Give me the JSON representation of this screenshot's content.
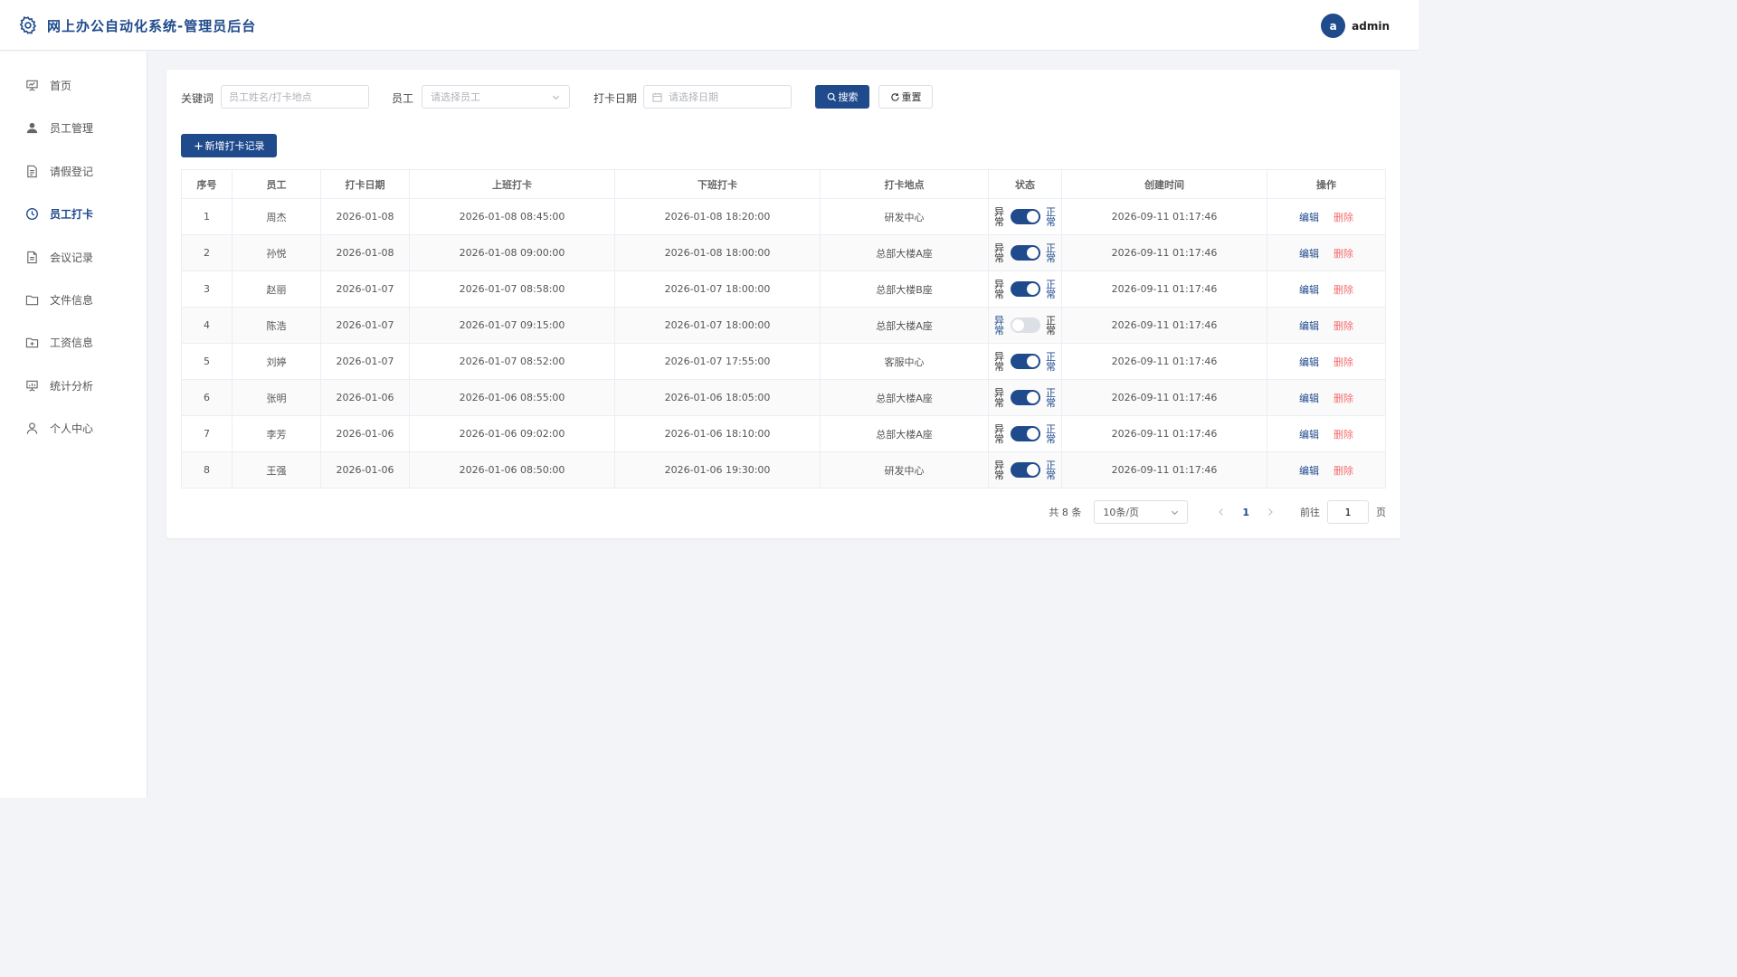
{
  "header": {
    "title": "网上办公自动化系统-管理员后台",
    "logo_icon": "gear-icon",
    "user": {
      "avatar_letter": "a",
      "name": "admin"
    }
  },
  "sidebar": {
    "items": [
      {
        "label": "首页",
        "icon": "presentation-icon",
        "active": false
      },
      {
        "label": "员工管理",
        "icon": "user-icon",
        "active": false
      },
      {
        "label": "请假登记",
        "icon": "document-icon",
        "active": false
      },
      {
        "label": "员工打卡",
        "icon": "clock-icon",
        "active": true
      },
      {
        "label": "会议记录",
        "icon": "document-list-icon",
        "active": false
      },
      {
        "label": "文件信息",
        "icon": "folder-icon",
        "active": false
      },
      {
        "label": "工资信息",
        "icon": "folder-add-icon",
        "active": false
      },
      {
        "label": "统计分析",
        "icon": "chart-board-icon",
        "active": false
      },
      {
        "label": "个人中心",
        "icon": "person-icon",
        "active": false
      }
    ]
  },
  "filters": {
    "keyword_label": "关键词",
    "keyword_placeholder": "员工姓名/打卡地点",
    "keyword_value": "",
    "employee_label": "员工",
    "employee_placeholder": "请选择员工",
    "date_label": "打卡日期",
    "date_placeholder": "请选择日期",
    "search_label": "搜索",
    "reset_label": "重置"
  },
  "add_button_label": "新增打卡记录",
  "table": {
    "columns": [
      "序号",
      "员工",
      "打卡日期",
      "上班打卡",
      "下班打卡",
      "打卡地点",
      "状态",
      "创建时间",
      "操作"
    ],
    "status_off_text": "异常",
    "status_on_text": "正常",
    "edit_label": "编辑",
    "delete_label": "删除",
    "rows": [
      {
        "index": "1",
        "employee": "周杰",
        "date": "2026-01-08",
        "clock_in": "2026-01-08 08:45:00",
        "clock_out": "2026-01-08 18:20:00",
        "location": "研发中心",
        "status_on": true,
        "created": "2026-09-11 01:17:46"
      },
      {
        "index": "2",
        "employee": "孙悦",
        "date": "2026-01-08",
        "clock_in": "2026-01-08 09:00:00",
        "clock_out": "2026-01-08 18:00:00",
        "location": "总部大楼A座",
        "status_on": true,
        "created": "2026-09-11 01:17:46"
      },
      {
        "index": "3",
        "employee": "赵丽",
        "date": "2026-01-07",
        "clock_in": "2026-01-07 08:58:00",
        "clock_out": "2026-01-07 18:00:00",
        "location": "总部大楼B座",
        "status_on": true,
        "created": "2026-09-11 01:17:46"
      },
      {
        "index": "4",
        "employee": "陈浩",
        "date": "2026-01-07",
        "clock_in": "2026-01-07 09:15:00",
        "clock_out": "2026-01-07 18:00:00",
        "location": "总部大楼A座",
        "status_on": false,
        "created": "2026-09-11 01:17:46"
      },
      {
        "index": "5",
        "employee": "刘婷",
        "date": "2026-01-07",
        "clock_in": "2026-01-07 08:52:00",
        "clock_out": "2026-01-07 17:55:00",
        "location": "客服中心",
        "status_on": true,
        "created": "2026-09-11 01:17:46"
      },
      {
        "index": "6",
        "employee": "张明",
        "date": "2026-01-06",
        "clock_in": "2026-01-06 08:55:00",
        "clock_out": "2026-01-06 18:05:00",
        "location": "总部大楼A座",
        "status_on": true,
        "created": "2026-09-11 01:17:46"
      },
      {
        "index": "7",
        "employee": "李芳",
        "date": "2026-01-06",
        "clock_in": "2026-01-06 09:02:00",
        "clock_out": "2026-01-06 18:10:00",
        "location": "总部大楼A座",
        "status_on": true,
        "created": "2026-09-11 01:17:46"
      },
      {
        "index": "8",
        "employee": "王强",
        "date": "2026-01-06",
        "clock_in": "2026-01-06 08:50:00",
        "clock_out": "2026-01-06 19:30:00",
        "location": "研发中心",
        "status_on": true,
        "created": "2026-09-11 01:17:46"
      }
    ]
  },
  "pagination": {
    "total_text": "共 8 条",
    "page_size": "10条/页",
    "current_page": "1",
    "goto_label": "前往",
    "goto_value": "1",
    "page_suffix": "页"
  },
  "colors": {
    "primary": "#1f4a8c",
    "danger": "#f56c6c",
    "background": "#f2f4f8"
  }
}
